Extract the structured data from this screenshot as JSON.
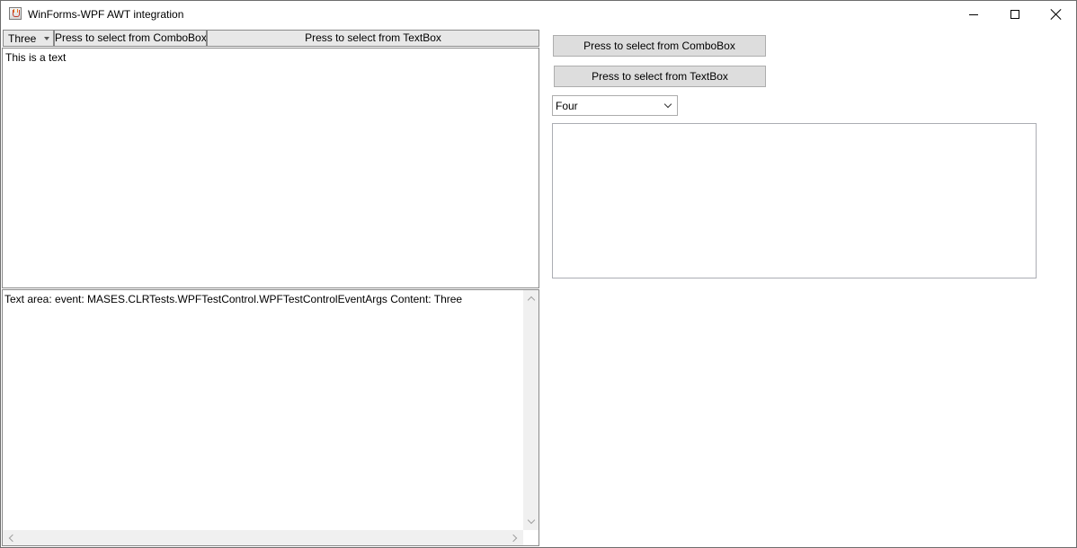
{
  "window": {
    "title": "WinForms-WPF AWT integration",
    "icon": "java-cup-icon",
    "controls": {
      "minimize": "minimize-icon",
      "maximize": "maximize-icon",
      "close": "close-icon"
    }
  },
  "awt_panel": {
    "combo": {
      "value": "Three"
    },
    "select_from_combobox_label": "Press to select from ComboBox",
    "select_from_textbox_label": "Press to select from TextBox",
    "textbox": {
      "value": "This is a text"
    }
  },
  "text_area": {
    "content": "Text area: event: MASES.CLRTests.WPFTestControl.WPFTestControlEventArgs Content: Three"
  },
  "wpf_panel": {
    "select_from_combobox_label": "Press to select from ComboBox",
    "select_from_textbox_label": "Press to select from TextBox",
    "combo": {
      "value": "Four"
    },
    "textbox": {
      "value": ""
    }
  }
}
